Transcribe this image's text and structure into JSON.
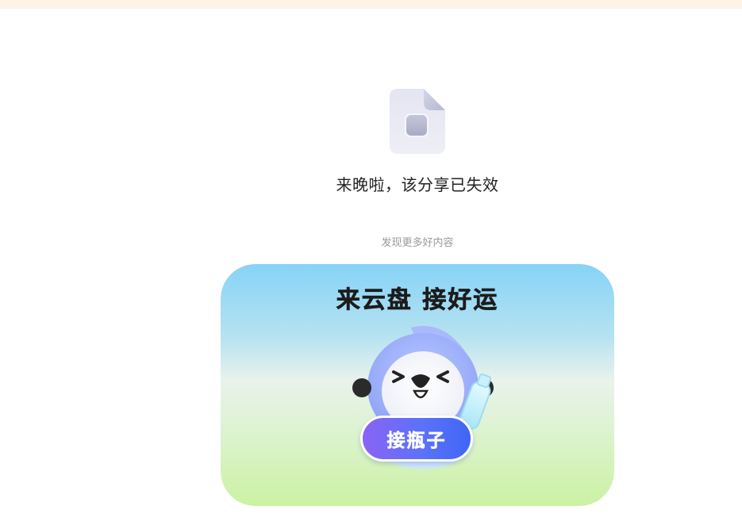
{
  "colors": {
    "top_strip": "#fdf3e6",
    "message_text": "#222222",
    "discover_text": "#9a9a9a",
    "card_top": "#86d3f7",
    "card_bottom": "#cbf2a3",
    "button_start": "#8b63f5",
    "button_end": "#3f66f5"
  },
  "status": {
    "icon": "file-icon",
    "message": "来晚啦，该分享已失效"
  },
  "discover": {
    "label": "发现更多好内容"
  },
  "promo": {
    "title": "来云盘 接好运",
    "mascot_icon": "bird-mascot-icon",
    "button_label": "接瓶子"
  }
}
